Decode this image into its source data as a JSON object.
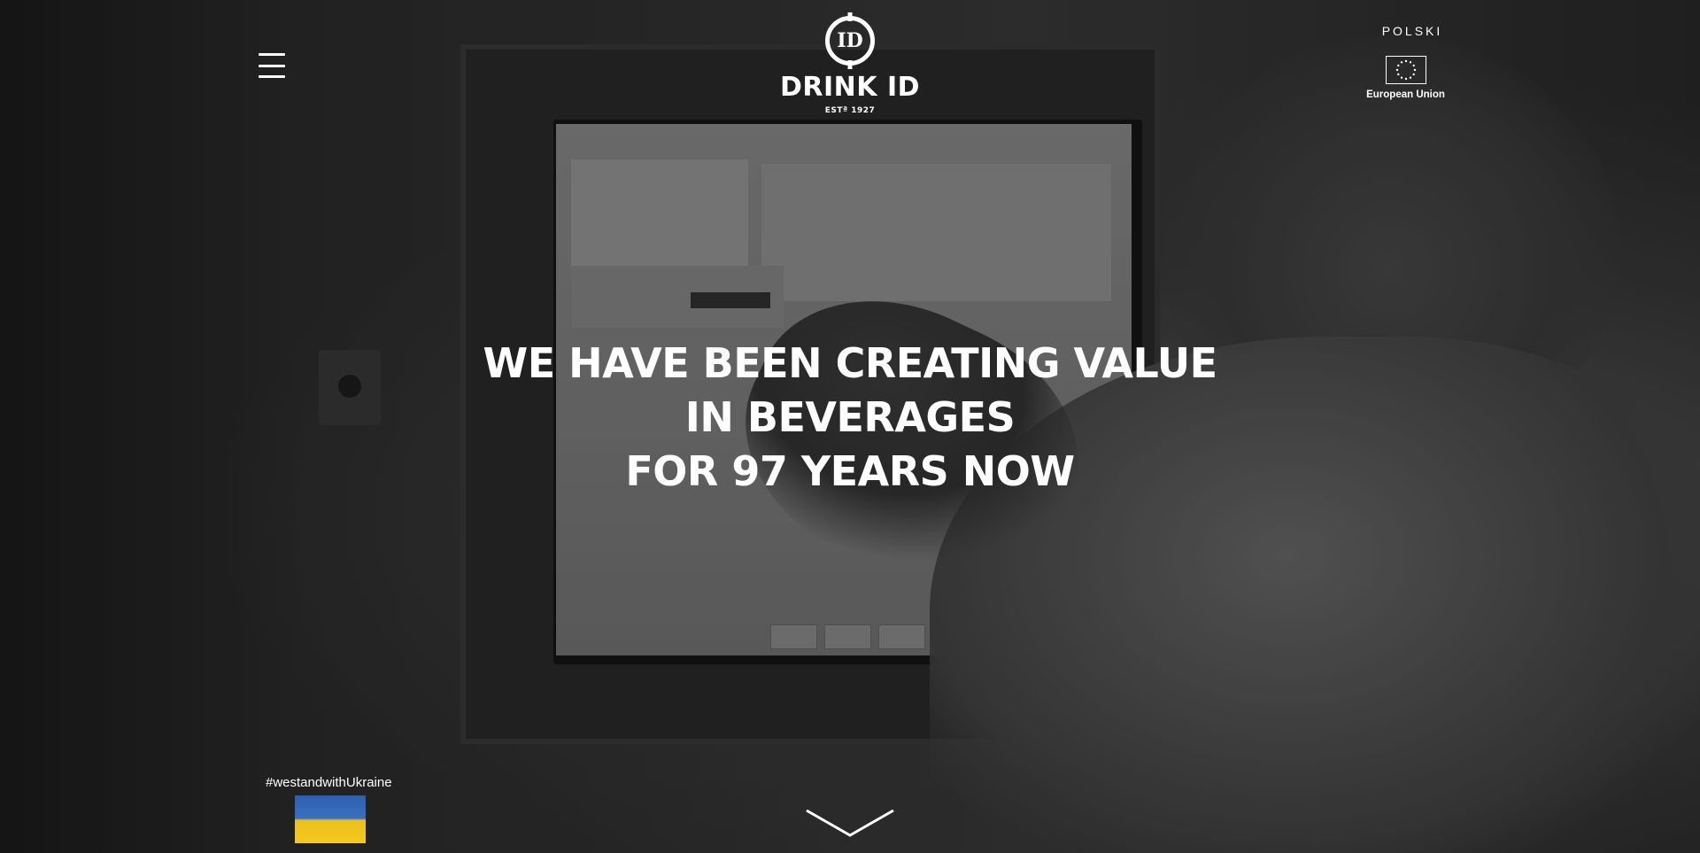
{
  "header": {
    "menu_icon": "hamburger-menu-icon",
    "logo": {
      "mark": "ID",
      "name": "DRINK ID",
      "established": "ESTª 1927"
    },
    "language_link": "POLSKI",
    "eu_badge": {
      "icon": "eu-stars-flag-icon",
      "label": "European Union"
    }
  },
  "hero": {
    "headline_lines": [
      "WE HAVE BEEN CREATING VALUE",
      "IN BEVERAGES",
      "FOR 97 YEARS NOW"
    ]
  },
  "footer_badge": {
    "hashtag": "#westandwithUkraine",
    "flag_icon": "ukraine-flag-icon",
    "colors": {
      "blue": "#3f6fb5",
      "yellow": "#f1c92e"
    }
  },
  "scroll_indicator": {
    "icon": "chevron-down-icon"
  },
  "colors": {
    "text": "#ffffff",
    "background": "#2a2a2a"
  }
}
